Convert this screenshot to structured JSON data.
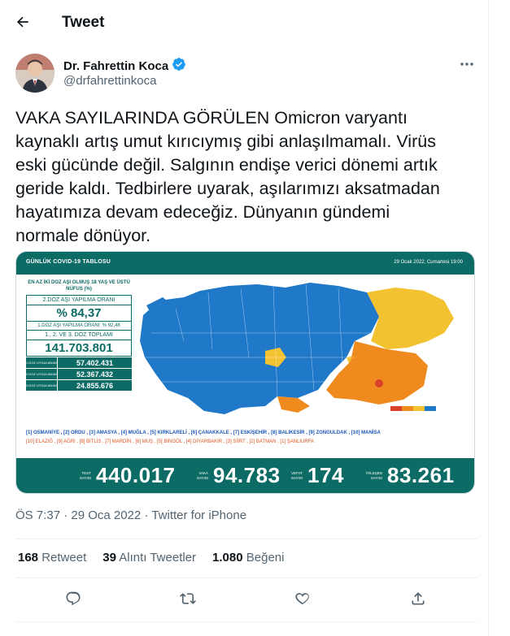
{
  "header": {
    "title": "Tweet",
    "back_icon": "arrow-left-icon"
  },
  "author": {
    "name": "Dr. Fahrettin Koca",
    "handle": "@drfahrettinkoca",
    "verified": true
  },
  "tweet": {
    "text": "VAKA SAYILARINDA GÖRÜLEN Omicron varyantı\nkaynaklı artış umut kırıcıymış gibi anlaşılmamalı. Virüs\neski gücünde değil. Salgının endişe verici dönemi artık\ngeride kaldı. Tedbirlere uyarak, aşılarımızı aksatmadan\nhayatımıza devam edeceğiz. Dünyanın gündemi\nnormale dönüyor."
  },
  "media": {
    "title": "GÜNLÜK COVID-19 TABLOSU",
    "date": "29 Ocak 2022, Cumartesi 19:00",
    "left_head": "EN AZ İKİ DOZ AŞI OLMUŞ 18 YAŞ VE ÜSTÜ NÜFUS (%)",
    "dose2_label": "2.DOZ AŞI YAPILMA ORANI",
    "dose2_value": "% 84,37",
    "dose1_label": "1.DOZ AŞI YAPILMA ORANI: % 92,48",
    "total_label": "1., 2. VE 3. DOZ TOPLAMI",
    "total_value": "141.703.801",
    "doses": [
      {
        "label": "1.DOZ UYGULANAN",
        "value": "57.402.431"
      },
      {
        "label": "2.DOZ UYGULANAN",
        "value": "52.367.432"
      },
      {
        "label": "3.DOZ UYGULANAN",
        "value": "24.855.676"
      }
    ],
    "city_line_1": "[1] OSMANİYE , [2] ORDU , [3] AMASYA , [4] MUĞLA , [5] KIRKLARELİ , [6] ÇANAKKALE , [7] ESKİŞEHİR , [8] BALIKESİR , [9] ZONGULDAK , [10] MANİSA",
    "city_line_2a": "[10] ELAZIĞ , [9] AĞRI , [8] BİTLİS , [7] MARDİN , [6] MUŞ , [5] BİNGÖL , [4] DİYARBAKIR , [3] SİİRT , [2] BATMAN , [1] ŞANLIURFA",
    "stats": [
      {
        "label": "TEST SAYISI",
        "value": "440.017"
      },
      {
        "label": "VAKA SAYISI",
        "value": "94.783"
      },
      {
        "label": "VEFAT SAYISI",
        "value": "174"
      },
      {
        "label": "İYİLEŞEN SAYISI",
        "value": "83.261"
      }
    ],
    "colors": {
      "teal": "#0d6b66",
      "blue": "#1f78c8",
      "yellow": "#f2c230",
      "orange": "#ef8a1e",
      "red": "#d9412a"
    }
  },
  "meta": {
    "time": "ÖS 7:37 · 29 Oca 2022 · Twitter for iPhone"
  },
  "counts": [
    {
      "number": "168",
      "label": "Retweet"
    },
    {
      "number": "39",
      "label": "Alıntı Tweetler"
    },
    {
      "number": "1.080",
      "label": "Beğeni"
    }
  ],
  "actions": [
    "reply-icon",
    "retweet-icon",
    "like-icon",
    "share-icon"
  ]
}
